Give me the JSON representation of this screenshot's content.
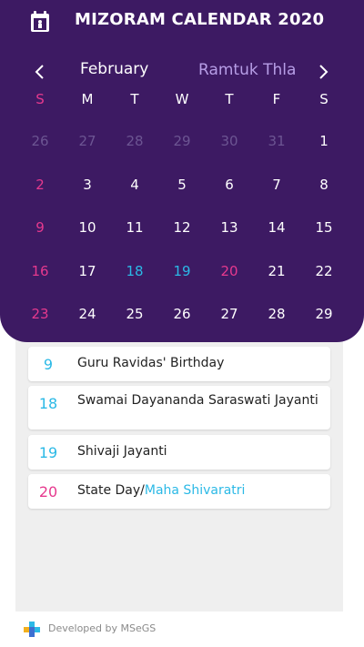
{
  "app": {
    "title": "MIZORAM CALENDAR 2020"
  },
  "nav": {
    "prev_icon": "chevron-left-icon",
    "next_icon": "chevron-right-icon"
  },
  "month": {
    "name": "February",
    "mizo_name": "Ramtuk Thla"
  },
  "weekdays": [
    "S",
    "M",
    "T",
    "W",
    "T",
    "F",
    "S"
  ],
  "weeks": [
    [
      {
        "d": "26",
        "t": "other"
      },
      {
        "d": "27",
        "t": "other"
      },
      {
        "d": "28",
        "t": "other"
      },
      {
        "d": "29",
        "t": "other"
      },
      {
        "d": "30",
        "t": "other"
      },
      {
        "d": "31",
        "t": "other"
      },
      {
        "d": "1",
        "t": ""
      }
    ],
    [
      {
        "d": "2",
        "t": "sunday"
      },
      {
        "d": "3",
        "t": ""
      },
      {
        "d": "4",
        "t": ""
      },
      {
        "d": "5",
        "t": ""
      },
      {
        "d": "6",
        "t": ""
      },
      {
        "d": "7",
        "t": ""
      },
      {
        "d": "8",
        "t": ""
      }
    ],
    [
      {
        "d": "9",
        "t": "sunday"
      },
      {
        "d": "10",
        "t": ""
      },
      {
        "d": "11",
        "t": ""
      },
      {
        "d": "12",
        "t": ""
      },
      {
        "d": "13",
        "t": ""
      },
      {
        "d": "14",
        "t": ""
      },
      {
        "d": "15",
        "t": ""
      }
    ],
    [
      {
        "d": "16",
        "t": "sunday"
      },
      {
        "d": "17",
        "t": ""
      },
      {
        "d": "18",
        "t": "holiday-blue"
      },
      {
        "d": "19",
        "t": "holiday-blue"
      },
      {
        "d": "20",
        "t": "holiday-pink"
      },
      {
        "d": "21",
        "t": ""
      },
      {
        "d": "22",
        "t": ""
      }
    ],
    [
      {
        "d": "23",
        "t": "sunday"
      },
      {
        "d": "24",
        "t": ""
      },
      {
        "d": "25",
        "t": ""
      },
      {
        "d": "26",
        "t": ""
      },
      {
        "d": "27",
        "t": ""
      },
      {
        "d": "28",
        "t": ""
      },
      {
        "d": "29",
        "t": ""
      }
    ]
  ],
  "events": [
    {
      "date": "9",
      "text": "Guru Ravidas' Birthday",
      "alt": "",
      "color": "blue"
    },
    {
      "date": "18",
      "text": "Swamai Dayananda Saraswati Jayanti",
      "alt": "",
      "color": "blue"
    },
    {
      "date": "19",
      "text": "Shivaji Jayanti",
      "alt": "",
      "color": "blue"
    },
    {
      "date": "20",
      "text": "State Day/",
      "alt": "Maha Shivaratri",
      "color": "pink"
    }
  ],
  "footer": {
    "text": "Developed by MSeGS",
    "logo_icon": "msegs-logo-icon"
  },
  "colors": {
    "header_bg": "#3d1a63",
    "accent_pink": "#e6398e",
    "accent_blue": "#2bb9e6",
    "mizo_month": "#b79ee6",
    "list_bg": "#efefef"
  }
}
